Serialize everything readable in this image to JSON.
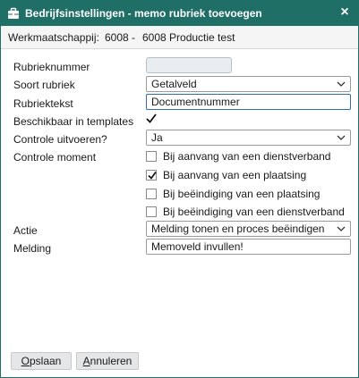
{
  "window": {
    "title": "Bedrijfsinstellingen - memo rubriek toevoegen",
    "close_glyph": "×",
    "icon": "briefcase-icon"
  },
  "info": {
    "label": "Werkmaatschappij:",
    "code": "6008",
    "separator": "-",
    "name": "6008 Productie test"
  },
  "form": {
    "rubrieknummer": {
      "label": "Rubrieknummer",
      "value": ""
    },
    "soort_rubriek": {
      "label": "Soort rubriek",
      "value": "Getalveld"
    },
    "rubriektekst": {
      "label": "Rubriektekst",
      "value": "Documentnummer"
    },
    "beschikbaar_templates": {
      "label": "Beschikbaar in templates",
      "checked": true
    },
    "controle_uitvoeren": {
      "label": "Controle uitvoeren?",
      "value": "Ja"
    },
    "controle_moment": {
      "label": "Controle moment",
      "options": [
        {
          "label": "Bij aanvang van een dienstverband",
          "checked": false
        },
        {
          "label": "Bij aanvang van een plaatsing",
          "checked": true
        },
        {
          "label": "Bij beëindiging van een plaatsing",
          "checked": false
        },
        {
          "label": "Bij beëindiging van een dienstverband",
          "checked": false
        }
      ]
    },
    "actie": {
      "label": "Actie",
      "value": "Melding tonen en proces beëindigen"
    },
    "melding": {
      "label": "Melding",
      "value": "Memoveld invullen!"
    }
  },
  "buttons": {
    "save": {
      "first": "O",
      "rest": "pslaan"
    },
    "cancel": {
      "first": "A",
      "rest": "nnuleren"
    }
  },
  "colors": {
    "titlebar": "#1f6f66",
    "focus_border": "#2f6cb3",
    "disabled_bg": "#e8edf2"
  }
}
